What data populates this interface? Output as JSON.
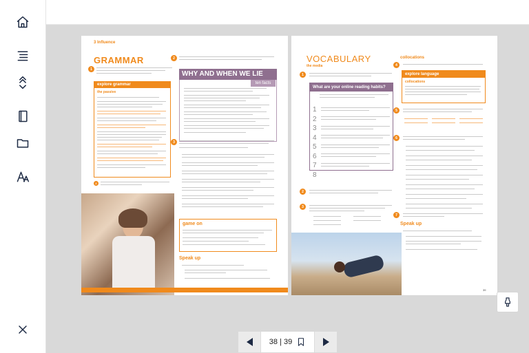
{
  "sidebar": {
    "items": [
      {
        "name": "home",
        "icon": "home-icon"
      },
      {
        "name": "contents",
        "icon": "list-icon"
      },
      {
        "name": "expand",
        "icon": "expand-icon"
      },
      {
        "name": "notebook",
        "icon": "notebook-icon"
      },
      {
        "name": "folder",
        "icon": "folder-icon"
      },
      {
        "name": "text-size",
        "icon": "font-size-icon"
      },
      {
        "name": "close",
        "icon": "close-icon"
      }
    ]
  },
  "left_page": {
    "unit": "3 Influence",
    "title": "GRAMMAR",
    "box_title": "explore grammar",
    "box_sub": "the passive",
    "why_title": "WHY AND WHEN WE LIE",
    "ten_facts": "ten facts",
    "game_on": "game on",
    "speak_up": "Speak up"
  },
  "right_page": {
    "title": "VOCABULARY",
    "media": "the media",
    "question": "What are your online reading habits?",
    "collocations": "collocations",
    "explore_language": "explore language",
    "speak_up": "Speak up",
    "page_number": "39"
  },
  "pager": {
    "label": "38 | 39"
  },
  "colors": {
    "accent": "#f08a1c",
    "nav": "#1d2a44",
    "viewer_bg": "#d9d9d9",
    "why_bar": "#8f6f8f"
  }
}
